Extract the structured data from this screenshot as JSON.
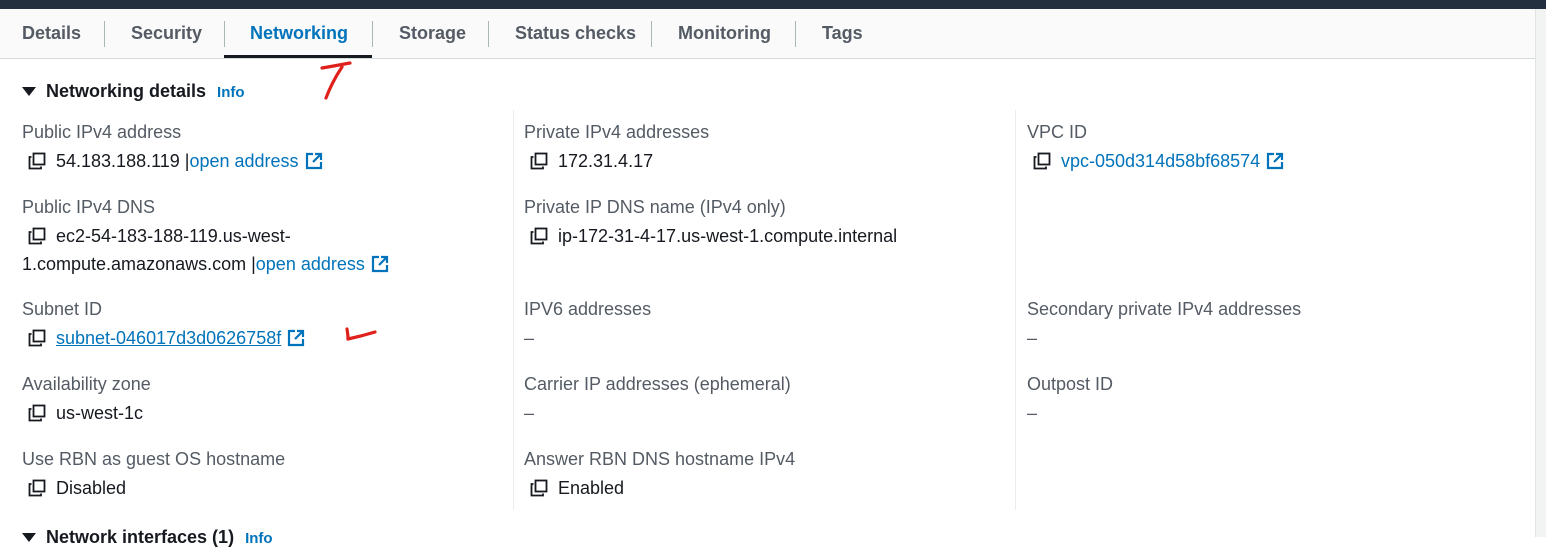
{
  "tabs": [
    {
      "label": "Details"
    },
    {
      "label": "Security"
    },
    {
      "label": "Networking"
    },
    {
      "label": "Storage"
    },
    {
      "label": "Status checks"
    },
    {
      "label": "Monitoring"
    },
    {
      "label": "Tags"
    }
  ],
  "active_tab": "Networking",
  "networking_details": {
    "title": "Networking details",
    "info": "Info",
    "public_ipv4": {
      "label": "Public IPv4 address",
      "value": "54.183.188.119 |",
      "link": "open address"
    },
    "public_dns": {
      "label": "Public IPv4 DNS",
      "value": "ec2-54-183-188-119.us-west-",
      "value2": "1.compute.amazonaws.com |",
      "link": "open address"
    },
    "subnet": {
      "label": "Subnet ID",
      "link": "subnet-046017d3d0626758f"
    },
    "az": {
      "label": "Availability zone",
      "value": "us-west-1c"
    },
    "rbn_hostname": {
      "label": "Use RBN as guest OS hostname",
      "value": "Disabled"
    },
    "private_ipv4": {
      "label": "Private IPv4 addresses",
      "value": "172.31.4.17"
    },
    "private_dns": {
      "label": "Private IP DNS name (IPv4 only)",
      "value": "ip-172-31-4-17.us-west-1.compute.internal"
    },
    "ipv6": {
      "label": "IPV6 addresses",
      "value": "–"
    },
    "carrier_ip": {
      "label": "Carrier IP addresses (ephemeral)",
      "value": "–"
    },
    "answer_rbn": {
      "label": "Answer RBN DNS hostname IPv4",
      "value": "Enabled"
    },
    "vpc": {
      "label": "VPC ID",
      "link": "vpc-050d314d58bf68574"
    },
    "secondary_ipv4": {
      "label": "Secondary private IPv4 addresses",
      "value": "–"
    },
    "outpost": {
      "label": "Outpost ID",
      "value": "–"
    }
  },
  "network_interfaces": {
    "title": "Network interfaces (1)",
    "info": "Info"
  },
  "colors": {
    "accent": "#0073bb",
    "annotation": "#e0201b",
    "header": "#232f3e"
  },
  "icons": {
    "copy": "copy-icon",
    "external": "external-link-icon",
    "caret": "caret-down-icon"
  }
}
